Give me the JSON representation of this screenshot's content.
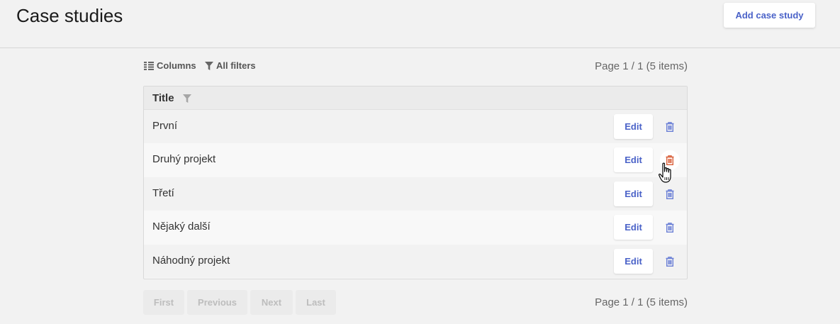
{
  "page": {
    "title": "Case studies",
    "add_button": "Add case study"
  },
  "toolbar": {
    "columns_label": "Columns",
    "filters_label": "All filters",
    "page_info": "Page 1 / 1 (5 items)"
  },
  "table": {
    "header_title": "Title",
    "rows": [
      {
        "title": "První",
        "edit": "Edit"
      },
      {
        "title": "Druhý projekt",
        "edit": "Edit"
      },
      {
        "title": "Třetí",
        "edit": "Edit"
      },
      {
        "title": "Nějaký další",
        "edit": "Edit"
      },
      {
        "title": "Náhodný projekt",
        "edit": "Edit"
      }
    ]
  },
  "pagination": {
    "first": "First",
    "previous": "Previous",
    "next": "Next",
    "last": "Last",
    "page_info": "Page 1 / 1 (5 items)"
  },
  "colors": {
    "accent": "#4a62c8",
    "trash": "#6b80d6",
    "trash_hover": "#d9603b"
  }
}
